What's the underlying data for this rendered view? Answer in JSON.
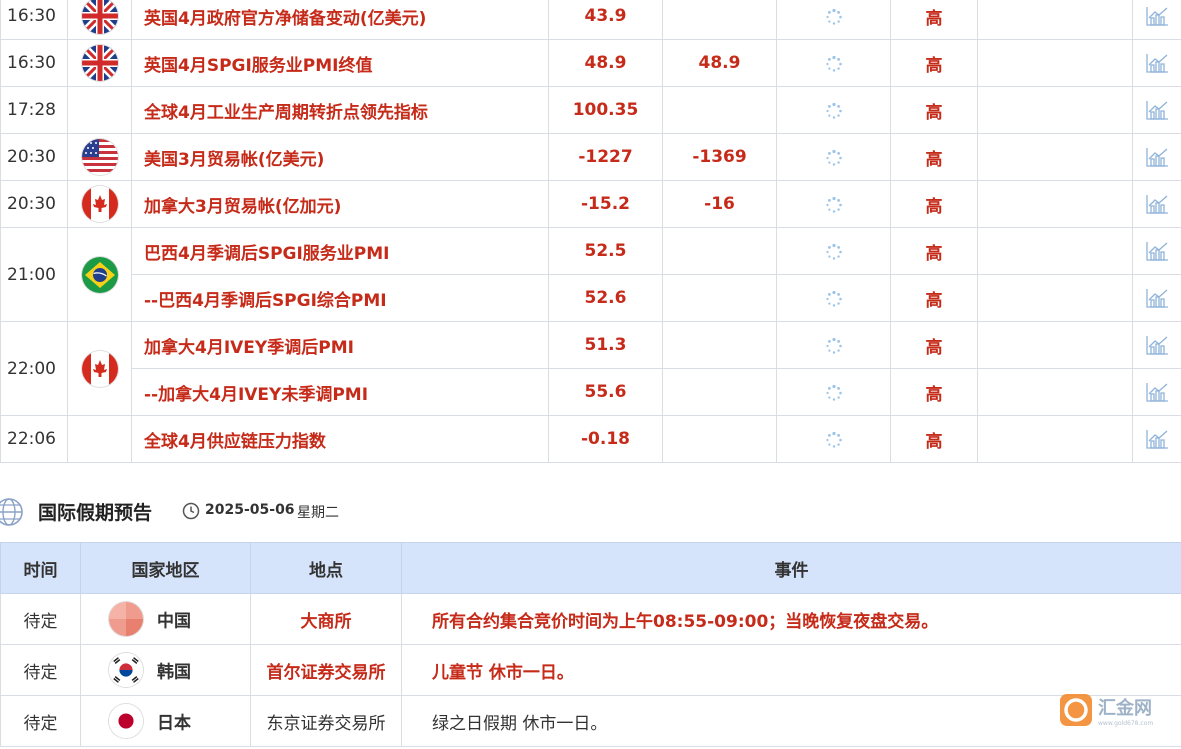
{
  "econ_rows": [
    {
      "time": "16:30",
      "flag": "uk-flag-icon",
      "event": "英国4月政府官方净储备变动(亿美元)",
      "previous": "43.9",
      "forecast": "",
      "importance": "高"
    },
    {
      "time": "16:30",
      "flag": "uk-flag-icon",
      "event": "英国4月SPGI服务业PMI终值",
      "previous": "48.9",
      "forecast": "48.9",
      "importance": "高"
    },
    {
      "time": "17:28",
      "flag": "",
      "event": "全球4月工业生产周期转折点领先指标",
      "previous": "100.35",
      "forecast": "",
      "importance": "高"
    },
    {
      "time": "20:30",
      "flag": "us-flag-icon",
      "event": "美国3月贸易帐(亿美元)",
      "previous": "-1227",
      "forecast": "-1369",
      "importance": "高"
    },
    {
      "time": "20:30",
      "flag": "canada-flag-icon",
      "event": "加拿大3月贸易帐(亿加元)",
      "previous": "-15.2",
      "forecast": "-16",
      "importance": "高"
    },
    {
      "time": "21:00",
      "flag": "brazil-flag-icon",
      "event": "巴西4月季调后SPGI服务业PMI",
      "previous": "52.5",
      "forecast": "",
      "importance": "高"
    },
    {
      "time": "",
      "flag": "",
      "event": "--巴西4月季调后SPGI综合PMI",
      "previous": "52.6",
      "forecast": "",
      "importance": "高"
    },
    {
      "time": "22:00",
      "flag": "canada-flag-icon",
      "event": "加拿大4月IVEY季调后PMI",
      "previous": "51.3",
      "forecast": "",
      "importance": "高"
    },
    {
      "time": "",
      "flag": "",
      "event": "--加拿大4月IVEY未季调PMI",
      "previous": "55.6",
      "forecast": "",
      "importance": "高"
    },
    {
      "time": "22:06",
      "flag": "",
      "event": "全球4月供应链压力指数",
      "previous": "-0.18",
      "forecast": "",
      "importance": "高"
    }
  ],
  "holidays": {
    "title": "国际假期预告",
    "date": "2025-05-06",
    "weekday": "星期二",
    "columns": [
      "时间",
      "国家地区",
      "地点",
      "事件"
    ],
    "rows": [
      {
        "time": "待定",
        "country": "中国",
        "flag": "china-flag-icon",
        "place": "大商所",
        "event": "所有合约集合竞价时间为上午08:55-09:00；当晚恢复夜盘交易。",
        "highlight": true
      },
      {
        "time": "待定",
        "country": "韩国",
        "flag": "korea-flag-icon",
        "place": "首尔证券交易所",
        "event": "儿童节 休市一日。",
        "highlight": true
      },
      {
        "time": "待定",
        "country": "日本",
        "flag": "japan-flag-icon",
        "place": "东京证券交易所",
        "event": "绿之日假期 休市一日。",
        "highlight": false
      }
    ]
  },
  "watermark": {
    "text": "汇金网",
    "sub": "www.gold678.com"
  },
  "colors": {
    "accent_red": "#c62b1a",
    "header_blue": "#d6e4fb",
    "border": "#d9dde4"
  }
}
